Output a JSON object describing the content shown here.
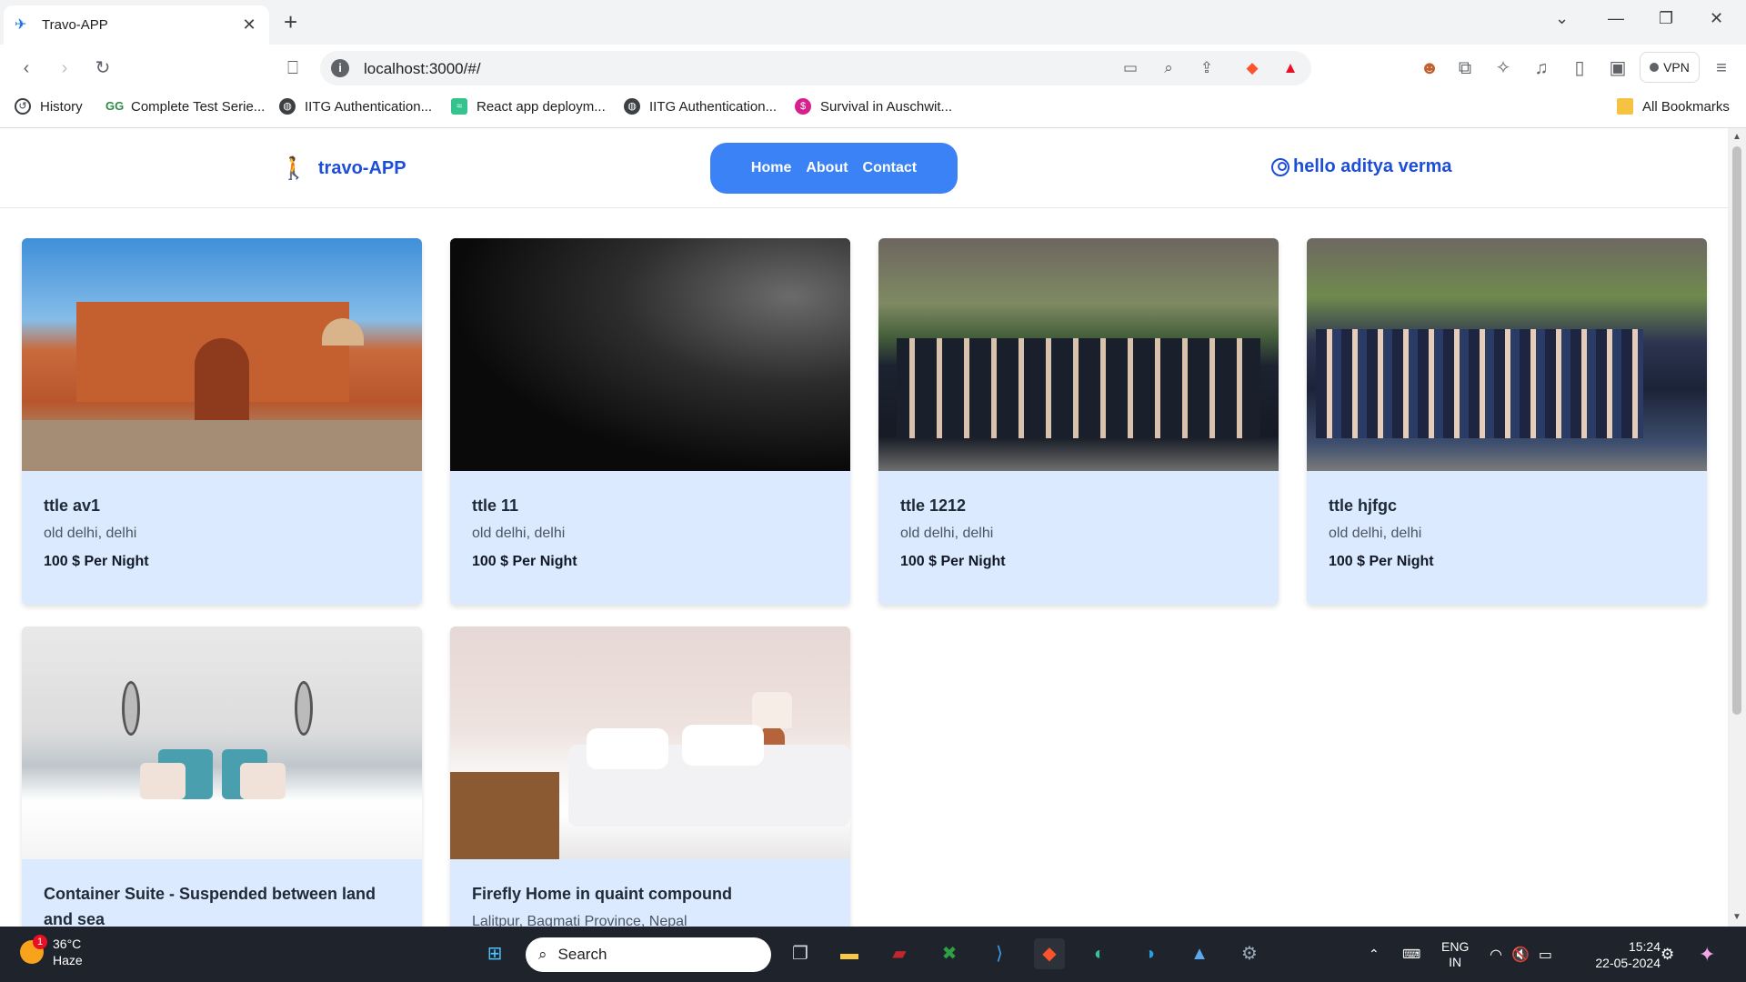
{
  "browser": {
    "tab_title": "Travo-APP",
    "new_tab": "+",
    "url": "localhost:3000/#/",
    "vpn_label": "VPN",
    "bookmarks": [
      {
        "label": "History",
        "icon": "history-icon"
      },
      {
        "label": "Complete Test Serie...",
        "icon": "gfg-icon"
      },
      {
        "label": "IITG Authentication...",
        "icon": "globe-icon"
      },
      {
        "label": "React app deploym...",
        "icon": "page-icon"
      },
      {
        "label": "IITG Authentication...",
        "icon": "globe-icon"
      },
      {
        "label": "Survival in Auschwit...",
        "icon": "dollar-icon"
      }
    ],
    "all_bookmarks": "All Bookmarks"
  },
  "app": {
    "brand": "travo-APP",
    "nav": {
      "home": "Home",
      "about": "About",
      "contact": "Contact"
    },
    "user_greeting": "hello aditya verma",
    "accent": "#3b82f6",
    "brand_color": "#1d4ed8",
    "card_bg": "#dbeafe"
  },
  "listings": [
    {
      "title": "ttle av1",
      "location": "old delhi, delhi",
      "price": "100 $ Per Night"
    },
    {
      "title": "ttle 11",
      "location": "old delhi, delhi",
      "price": "100 $ Per Night"
    },
    {
      "title": "ttle 1212",
      "location": "old delhi, delhi",
      "price": "100 $ Per Night"
    },
    {
      "title": "ttle hjfgc",
      "location": "old delhi, delhi",
      "price": "100 $ Per Night"
    },
    {
      "title": "Container Suite - Suspended between land and sea",
      "location": "",
      "price": ""
    },
    {
      "title": "Firefly Home in quaint compound",
      "location": "Lalitpur, Bagmati Province, Nepal",
      "price": ""
    }
  ],
  "taskbar": {
    "weather_temp": "36°C",
    "weather_desc": "Haze",
    "weather_badge": "1",
    "search_label": "Search",
    "lang_line1": "ENG",
    "lang_line2": "IN",
    "time": "15:24",
    "date": "22-05-2024"
  }
}
